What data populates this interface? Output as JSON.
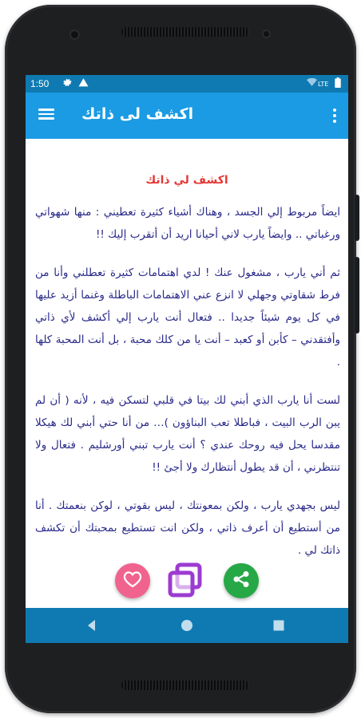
{
  "status_bar": {
    "time": "1:50",
    "icons": [
      "gear-icon",
      "warning-icon",
      "wifi-icon",
      "lte-signal-icon",
      "battery-icon"
    ],
    "network_label": "LTE"
  },
  "app_bar": {
    "title": "اكشف لى ذاتك",
    "menu_icon": "hamburger-menu-icon",
    "more_icon": "more-vert-icon"
  },
  "content": {
    "heading": "اكشف لي ذاتك",
    "paragraphs": [
      "ايضاً مربوط إلي الجسد ، وهناك أشياء كثيرة تعطيني : منها شهواتي ورغباتي .. وايضاً يارب لاني أحيانا اريد أن أتقرب إليك !!",
      "ثم أني يارب ، مشغول عنك ! لدي اهتمامات كثيرة تعطلني وأنا من فرط شقاوتي وجهلي لا انزع عني الاهتمامات الباطلة وغنما أزيد عليها في كل يوم شيئاً جديدا .. فتعال أنت يارب إلي أكشف لأي ذاتي وأفتقدني – كأبن أو كعبد – أنت يا من كلك محبة ، بل أنت المحبة كلها .",
      "لست أنا يارب الذي أبني لك بيتا في قلبي لتسكن فيه ، لأنه ( أن لم يبن الرب البيت ، فباطلا تعب البناؤون )… من أنا حتي أبني لك هيكلا مقدسا يحل فيه روحك عندي ؟ أنت يارب تبني أورشليم . فتعال ولا تنتظرني ، أن قد يطول أنتظارك ولا أجئ !!",
      "ليس بجهدي يارب ، ولكن بمعونتك ، ليس بقوتي ، لوكن بنعمتك . أنا من أستطيع أن أعرف ذاتي ، ولكن انت تستطيع بمحبتك أن تكشف ذاتك لي ."
    ]
  },
  "actions": {
    "like_icon": "heart-icon",
    "copy_icon": "copy-icon",
    "share_icon": "share-icon"
  },
  "nav_bar": {
    "icons": [
      "back-icon",
      "home-icon",
      "recents-icon"
    ]
  },
  "colors": {
    "status_bar": "#0f7ab2",
    "app_bar": "#1a9be3",
    "heading": "#e53935",
    "body_text": "#2a2a8a",
    "like": "#f0638f",
    "copy": "#9c3bd1",
    "share": "#27a846"
  }
}
